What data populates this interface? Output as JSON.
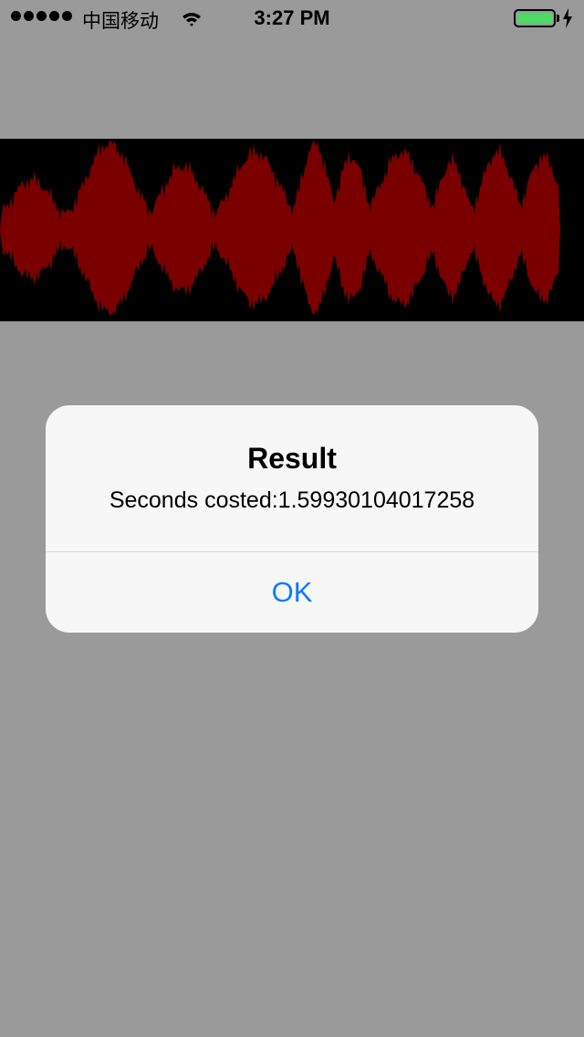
{
  "status_bar": {
    "carrier": "中国移动",
    "time": "3:27 PM",
    "signal_bars": 5,
    "battery_color": "#4cd964"
  },
  "waveform": {
    "background": "#000000",
    "fill_color": "#7a0000"
  },
  "alert": {
    "title": "Result",
    "message": "Seconds costed:1.59930104017258",
    "ok_label": "OK",
    "button_color": "#0a7aff"
  },
  "background_color": "#9a9a9a"
}
